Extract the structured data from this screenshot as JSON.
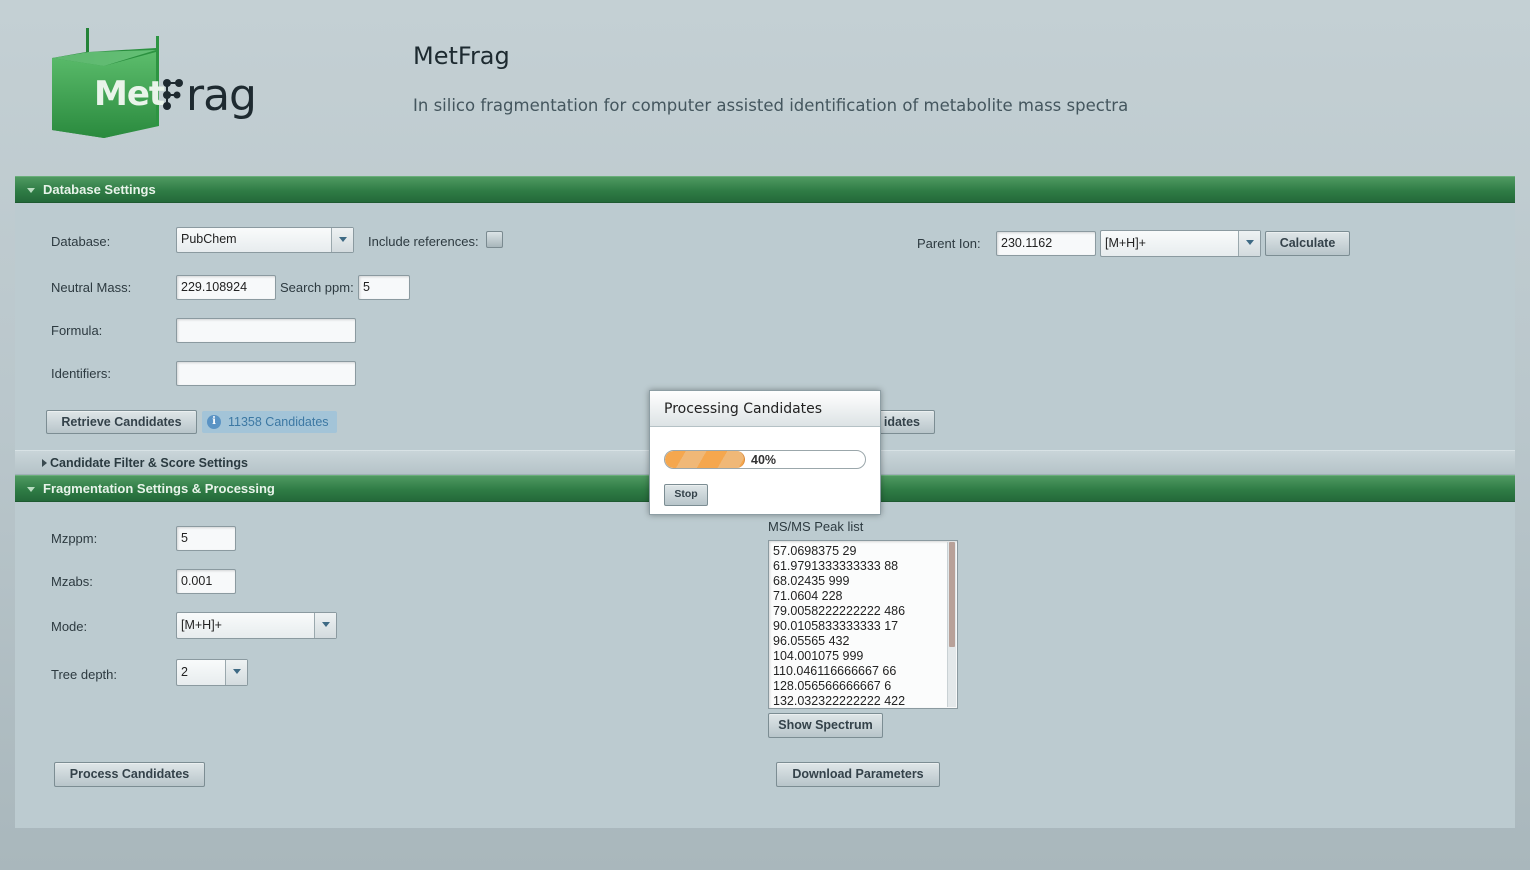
{
  "header": {
    "logo_text_left": "Met",
    "logo_text_right": "rag",
    "title": "MetFrag",
    "subtitle": "In silico fragmentation for computer assisted identification of metabolite mass spectra"
  },
  "database_panel": {
    "title": "Database Settings",
    "database_label": "Database:",
    "database_value": "PubChem",
    "include_refs_label": "Include references:",
    "include_refs_checked": false,
    "parent_ion_label": "Parent Ion:",
    "parent_ion_value": "230.1162",
    "parent_adduct_value": "[M+H]+",
    "calculate_label": "Calculate",
    "neutral_mass_label": "Neutral Mass:",
    "neutral_mass_value": "229.108924",
    "search_ppm_label": "Search ppm:",
    "search_ppm_value": "5",
    "formula_label": "Formula:",
    "formula_value": "",
    "identifiers_label": "Identifiers:",
    "identifiers_value": "",
    "retrieve_label": "Retrieve Candidates",
    "candidates_badge": "11358 Candidates",
    "hidden_button_fragment": "idates"
  },
  "filter_panel": {
    "title": "Candidate Filter & Score Settings"
  },
  "fragmentation_panel": {
    "title": "Fragmentation Settings & Processing",
    "mzppm_label": "Mzppm:",
    "mzppm_value": "5",
    "mzabs_label": "Mzabs:",
    "mzabs_value": "0.001",
    "mode_label": "Mode:",
    "mode_value": "[M+H]+",
    "tree_depth_label": "Tree depth:",
    "tree_depth_value": "2",
    "peaklist_label": "MS/MS Peak list",
    "peaks": [
      "57.0698375 29",
      "61.9791333333333 88",
      "68.02435 999",
      "71.0604 228",
      "79.0058222222222 486",
      "90.0105833333333 17",
      "96.05565 432",
      "104.001075 999",
      "110.046116666667 66",
      "128.056566666667 6",
      "132.032322222222 422"
    ],
    "show_spectrum_label": "Show Spectrum",
    "process_label": "Process Candidates",
    "download_label": "Download Parameters"
  },
  "dialog": {
    "title": "Processing Candidates",
    "progress_percent": 40,
    "progress_text": "40%",
    "stop_label": "Stop"
  },
  "colors": {
    "panel_header_green": "#2f7c45",
    "progress_orange": "#f5a74e",
    "logo_green": "#3a9a4e"
  }
}
